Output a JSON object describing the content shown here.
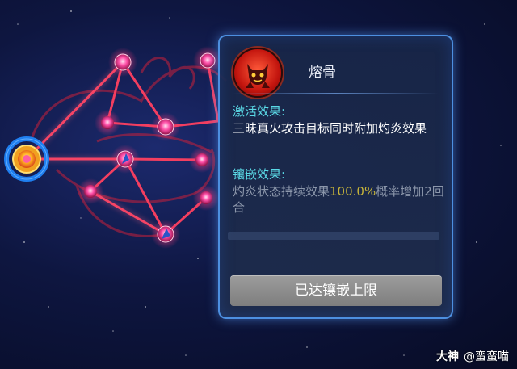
{
  "tooltip": {
    "skill_name": "熔骨",
    "skill_icon": "fire-demon-icon",
    "activate_title": "激活效果:",
    "activate_text": "三昧真火攻击目标同时附加灼炎效果",
    "inlay_title": "镶嵌效果:",
    "inlay_text_before": "灼炎状态持续效果",
    "inlay_highlight": "100.0%",
    "inlay_text_after": "概率增加2回合",
    "max_button_label": "已达镶嵌上限"
  },
  "watermark": {
    "brand": "大神",
    "handle": "@蛮蛮喵"
  },
  "colors": {
    "accent_cyan": "#5ad9e6",
    "highlight_gold": "#c8b53a",
    "constellation_red": "#ff2a55",
    "selected_ring": "#1f7ff0"
  }
}
